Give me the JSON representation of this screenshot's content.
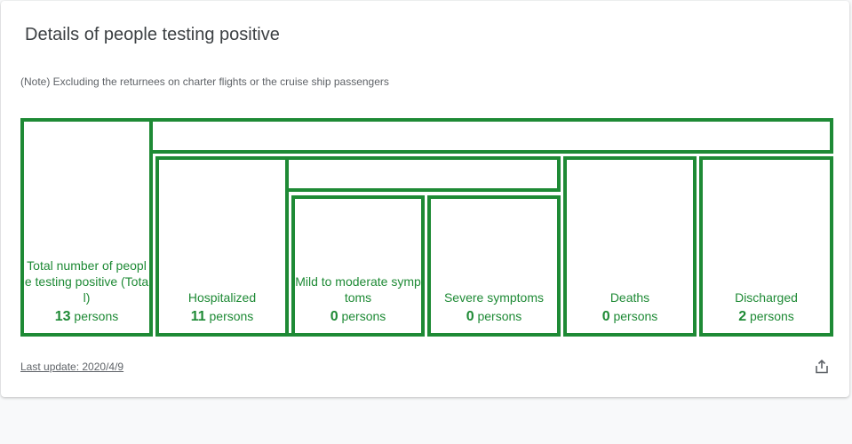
{
  "card": {
    "title": "Details of people testing positive",
    "note": "(Note) Excluding the returnees on charter flights or the cruise ship passengers",
    "last_update": "Last update: 2020/4/9"
  },
  "boxes": {
    "total": {
      "label": "Total number of people testing positive (Total)",
      "value": "13",
      "unit": " persons"
    },
    "hospitalized": {
      "label": "Hospitalized",
      "value": "11",
      "unit": " persons"
    },
    "mild": {
      "label": "Mild to moderate symptoms",
      "value": "0",
      "unit": " persons"
    },
    "severe": {
      "label": "Severe symptoms",
      "value": "0",
      "unit": " persons"
    },
    "deaths": {
      "label": "Deaths",
      "value": "0",
      "unit": " persons"
    },
    "discharged": {
      "label": "Discharged",
      "value": "2",
      "unit": " persons"
    }
  },
  "colors": {
    "accent": "#1e8a35",
    "title": "#3c4043",
    "muted": "#5f6368"
  },
  "icons": {
    "share": "share-icon"
  }
}
